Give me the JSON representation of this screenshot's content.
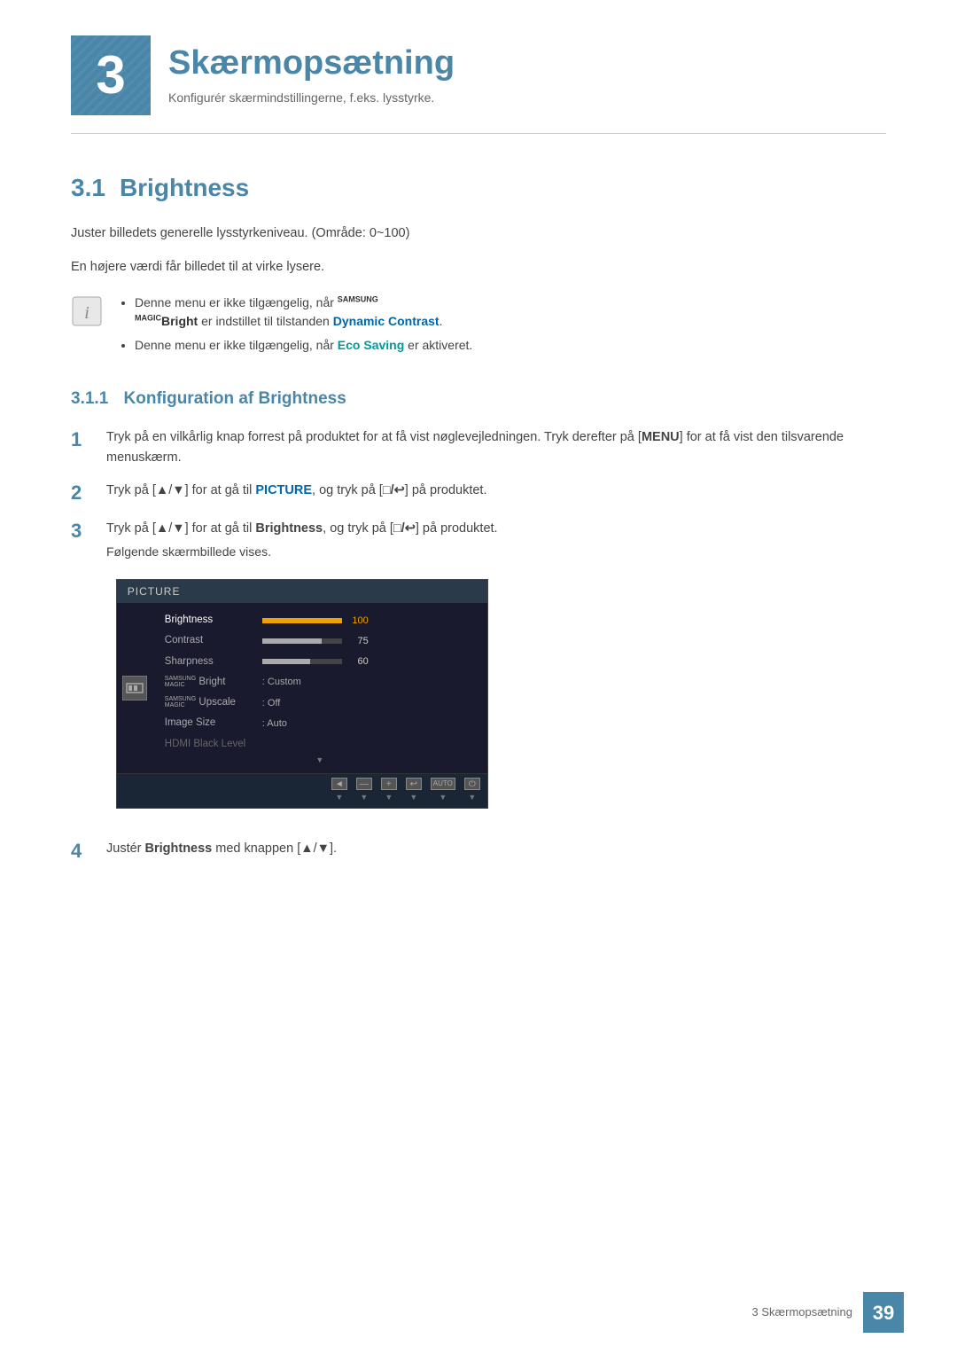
{
  "chapter": {
    "number": "3",
    "title": "Skærmopsætning",
    "subtitle": "Konfigurér skærmindstillingerne, f.eks. lysstyrke."
  },
  "section": {
    "number": "3.1",
    "title": "Brightness",
    "description1": "Juster billedets generelle lysstyrkeniveau. (Område: 0~100)",
    "description2": "En højere værdi får billedet til at virke lysere.",
    "note1_samsung": "SAMSUNG",
    "note1_magic": "MAGIC",
    "note1_bright": "Bright",
    "note1_text": "Denne menu er ikke tilgængelig, når",
    "note1_suffix": "er indstillet til tilstanden",
    "note1_dynamic": "Dynamic Contrast",
    "note2_text": "Denne menu er ikke tilgængelig, når",
    "note2_eco": "Eco Saving",
    "note2_suffix": "er aktiveret."
  },
  "subsection": {
    "number": "3.1.1",
    "title": "Konfiguration af Brightness"
  },
  "steps": [
    {
      "number": "1",
      "text": "Tryk på en vilkårlig knap forrest på produktet for at få vist nøglevejledningen. Tryk derefter på [",
      "key": "MENU",
      "text2": "] for at få vist den tilsvarende menuskærm."
    },
    {
      "number": "2",
      "text": "Tryk på [▲/▼] for at gå til ",
      "bold1": "PICTURE",
      "text2": ", og tryk på [",
      "key": "□/↩",
      "text3": "] på produktet."
    },
    {
      "number": "3",
      "text": "Tryk på [▲/▼] for at gå til ",
      "bold1": "Brightness",
      "text2": ", og tryk på [",
      "key": "□/↩",
      "text3": "] på produktet.",
      "note": "Følgende skærmbillede vises."
    },
    {
      "number": "4",
      "text": "Justér ",
      "bold1": "Brightness",
      "text2": " med knappen [▲/▼]."
    }
  ],
  "osd": {
    "header": "PICTURE",
    "items": [
      {
        "label": "Brightness",
        "type": "bar",
        "fillClass": "full",
        "value": "100",
        "active": true
      },
      {
        "label": "Contrast",
        "type": "bar",
        "fillClass": "w75",
        "value": "75",
        "active": false
      },
      {
        "label": "Sharpness",
        "type": "bar",
        "fillClass": "w60",
        "value": "60",
        "active": false
      },
      {
        "label": "Bright",
        "samsung": true,
        "type": "colon",
        "value": "Custom",
        "active": false
      },
      {
        "label": "Upscale",
        "samsung": true,
        "type": "colon",
        "value": "Off",
        "active": false
      },
      {
        "label": "Image Size",
        "type": "colon",
        "value": "Auto",
        "active": false
      },
      {
        "label": "HDMI Black Level",
        "type": "none",
        "value": "",
        "active": false
      }
    ],
    "footer_buttons": [
      {
        "icon": "◄",
        "label": ""
      },
      {
        "icon": "—",
        "label": ""
      },
      {
        "icon": "+",
        "label": ""
      },
      {
        "icon": "↩",
        "label": ""
      },
      {
        "icon": "AUTO",
        "label": ""
      },
      {
        "icon": "⏻",
        "label": ""
      }
    ]
  },
  "footer": {
    "chapter_label": "3 Skærmopsætning",
    "page_number": "39"
  }
}
